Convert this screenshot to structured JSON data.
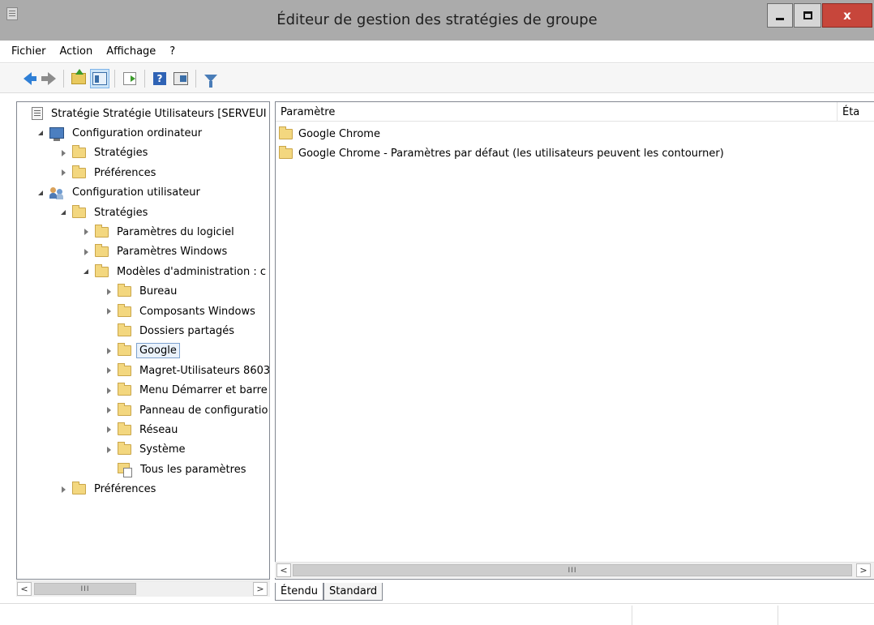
{
  "window": {
    "title": "Éditeur de gestion des stratégies de groupe",
    "minimize": "_",
    "maximize": "□",
    "close": "x"
  },
  "menu": [
    "Fichier",
    "Action",
    "Affichage",
    "?"
  ],
  "toolbar": {
    "icons": [
      "back-arrow",
      "forward-arrow",
      "up-folder",
      "show-hide-tree",
      "export-list",
      "help",
      "properties-view",
      "filter"
    ]
  },
  "tree": {
    "items": [
      {
        "label": "Stratégie Stratégie Utilisateurs [SERVEUI",
        "icon": "policy-icon",
        "level": 0,
        "expander": "none"
      },
      {
        "label": "Configuration ordinateur",
        "icon": "computer-icon",
        "level": 1,
        "expander": "open"
      },
      {
        "label": "Stratégies",
        "icon": "folder-icon",
        "level": 2,
        "expander": "closed"
      },
      {
        "label": "Préférences",
        "icon": "folder-icon",
        "level": 2,
        "expander": "closed"
      },
      {
        "label": "Configuration utilisateur",
        "icon": "users-icon",
        "level": 1,
        "expander": "open"
      },
      {
        "label": "Stratégies",
        "icon": "folder-icon",
        "level": 2,
        "expander": "open"
      },
      {
        "label": "Paramètres du logiciel",
        "icon": "folder-icon",
        "level": 3,
        "expander": "closed"
      },
      {
        "label": "Paramètres Windows",
        "icon": "folder-icon",
        "level": 3,
        "expander": "closed"
      },
      {
        "label": "Modèles d'administration : c",
        "icon": "folder-icon",
        "level": 3,
        "expander": "open"
      },
      {
        "label": "Bureau",
        "icon": "folder-icon",
        "level": 4,
        "expander": "closed"
      },
      {
        "label": "Composants Windows",
        "icon": "folder-icon",
        "level": 4,
        "expander": "closed"
      },
      {
        "label": "Dossiers partagés",
        "icon": "folder-icon",
        "level": 4,
        "expander": "none"
      },
      {
        "label": "Google",
        "icon": "folder-icon",
        "level": 4,
        "expander": "closed",
        "selected": true
      },
      {
        "label": "Magret-Utilisateurs 8603",
        "icon": "folder-icon",
        "level": 4,
        "expander": "closed"
      },
      {
        "label": "Menu Démarrer et barre",
        "icon": "folder-icon",
        "level": 4,
        "expander": "closed"
      },
      {
        "label": "Panneau de configuratio",
        "icon": "folder-icon",
        "level": 4,
        "expander": "closed"
      },
      {
        "label": "Réseau",
        "icon": "folder-icon",
        "level": 4,
        "expander": "closed"
      },
      {
        "label": "Système",
        "icon": "folder-icon",
        "level": 4,
        "expander": "closed"
      },
      {
        "label": "Tous les paramètres",
        "icon": "all-settings-icon",
        "level": 4,
        "expander": "none"
      },
      {
        "label": "Préférences",
        "icon": "folder-icon",
        "level": 2,
        "expander": "closed"
      }
    ]
  },
  "list": {
    "columns": [
      "Paramètre",
      "Éta"
    ],
    "rows": [
      {
        "label": "Google Chrome",
        "icon": "folder-icon"
      },
      {
        "label": "Google Chrome - Paramètres par défaut (les utilisateurs peuvent les contourner)",
        "icon": "folder-icon"
      }
    ]
  },
  "scrollbar": {
    "left": "<",
    "right": ">",
    "thumb": "III"
  },
  "tabs": [
    "Étendu",
    "Standard"
  ],
  "colors": {
    "titlebar": "#ababab",
    "close": "#c7463b",
    "selection_outline": "#7da2ce"
  }
}
